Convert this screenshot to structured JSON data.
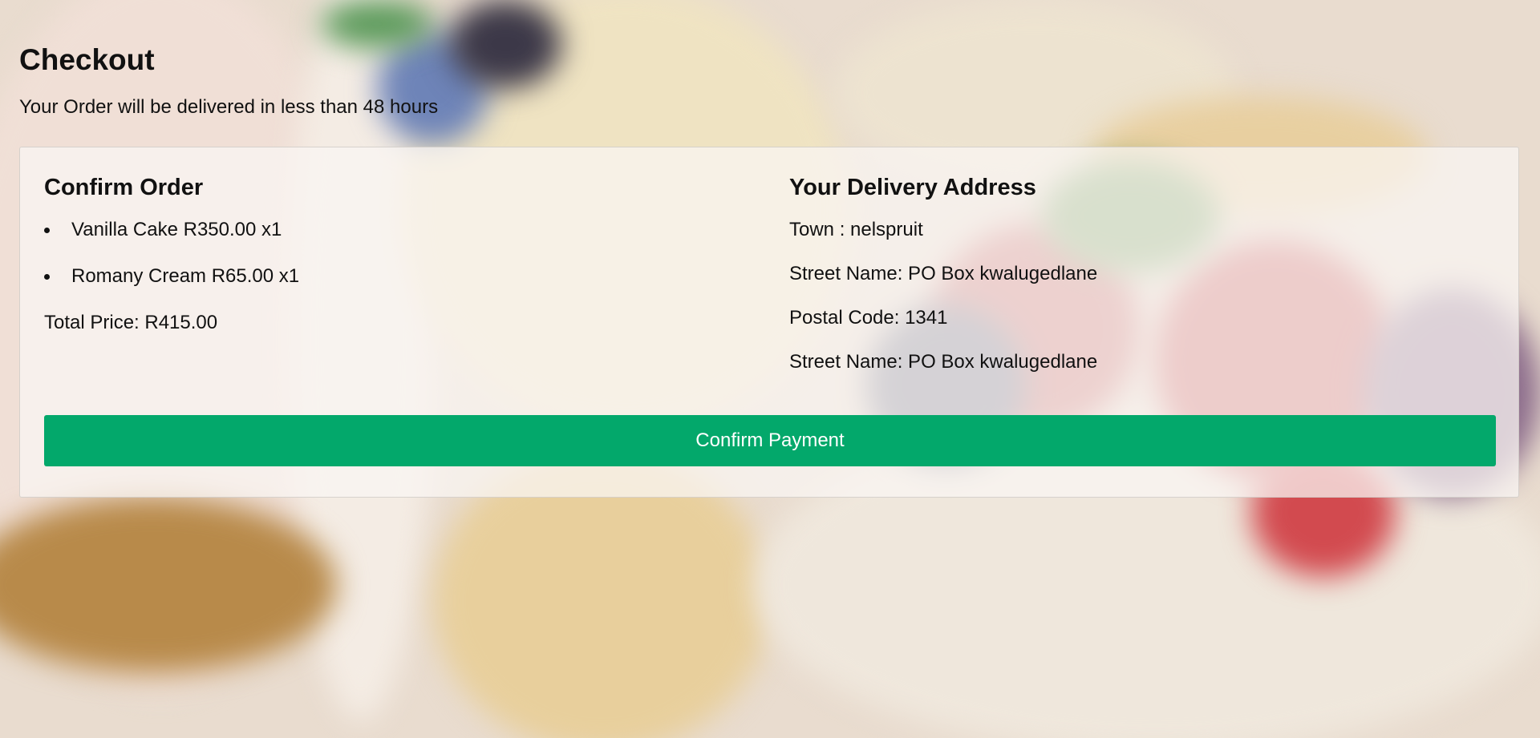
{
  "header": {
    "title": "Checkout",
    "subtitle": "Your Order will be delivered in less than 48 hours"
  },
  "order": {
    "heading": "Confirm Order",
    "items": [
      {
        "label": "Vanilla Cake R350.00 x1"
      },
      {
        "label": "Romany Cream R65.00 x1"
      }
    ],
    "total": "Total Price: R415.00"
  },
  "address": {
    "heading": "Your Delivery Address",
    "lines": [
      "Town : nelspruit",
      "Street Name: PO Box kwalugedlane",
      "Postal Code: 1341",
      "Street Name: PO Box kwalugedlane"
    ]
  },
  "actions": {
    "confirm_label": "Confirm Payment"
  },
  "colors": {
    "button": "#03a86b",
    "button_text": "#ffffff",
    "card_bg": "#faf6f3"
  }
}
